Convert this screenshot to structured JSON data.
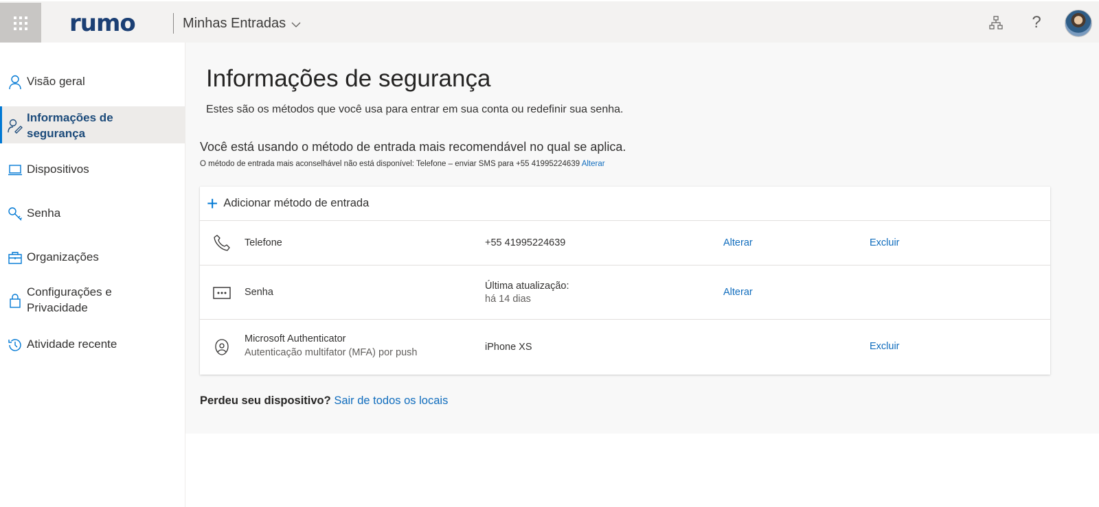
{
  "header": {
    "brand": "rumo",
    "app_title": "Minhas Entradas"
  },
  "sidebar": {
    "items": [
      {
        "label": "Visão geral",
        "icon": "person-icon"
      },
      {
        "label_line1": "Informações de",
        "label_line2": "segurança",
        "icon": "person-key-icon",
        "active": true
      },
      {
        "label": "Dispositivos",
        "icon": "laptop-icon"
      },
      {
        "label": "Senha",
        "icon": "key-icon"
      },
      {
        "label": "Organizações",
        "icon": "briefcase-icon"
      },
      {
        "label_line1": "Configurações e",
        "label_line2": "Privacidade",
        "icon": "lock-icon"
      },
      {
        "label": "Atividade recente",
        "icon": "history-icon"
      }
    ]
  },
  "main": {
    "title": "Informações de segurança",
    "subtitle": "Estes são os métodos que você usa para entrar em sua conta ou redefinir sua senha.",
    "recommendation_title": "Você está usando o método de entrada mais recomendável no qual se aplica.",
    "recommendation_text": "O método de entrada mais aconselhável não está disponível: Telefone – enviar SMS para +55 41995224639",
    "recommendation_link": "Alterar",
    "add_method": "Adicionar método de entrada",
    "methods": [
      {
        "name": "Telefone",
        "value": "+55 41995224639",
        "change": "Alterar",
        "delete": "Excluir",
        "icon": "phone-icon"
      },
      {
        "name": "Senha",
        "value_line1": "Última atualização:",
        "value_line2": "há 14 dias",
        "change": "Alterar",
        "icon": "password-dots-icon"
      },
      {
        "name": "Microsoft Authenticator",
        "description": "Autenticação multifator (MFA) por push",
        "value": "iPhone XS",
        "delete": "Excluir",
        "icon": "authenticator-icon"
      }
    ],
    "lost_device_question": "Perdeu seu dispositivo?",
    "lost_device_link": "Sair de todos os locais"
  },
  "colors": {
    "accent": "#0078d4",
    "link": "#0f6cbd",
    "brand": "#1b3f74",
    "header_bg": "#f3f2f1"
  }
}
